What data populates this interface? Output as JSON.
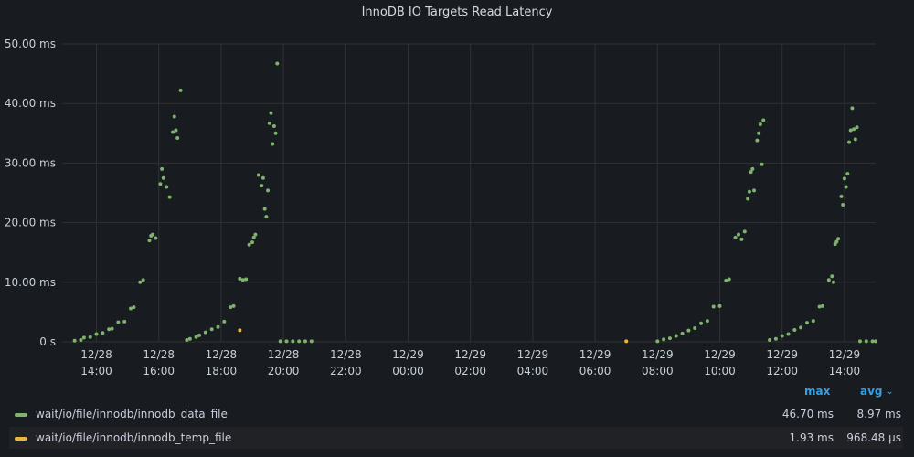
{
  "panel": {
    "title": "InnoDB IO Targets Read Latency"
  },
  "legend": {
    "col_max": "max",
    "col_avg": "avg",
    "sort_icon": "chevron-down-icon",
    "rows": [
      {
        "name": "wait/io/file/innodb/innodb_data_file",
        "color": "#7eb26d",
        "max": "46.70 ms",
        "avg": "8.97 ms"
      },
      {
        "name": "wait/io/file/innodb/innodb_temp_file",
        "color": "#eab839",
        "max": "1.93 ms",
        "avg": "968.48 µs"
      }
    ]
  },
  "chart_data": {
    "type": "scatter",
    "title": "InnoDB IO Targets Read Latency",
    "xlabel": "",
    "ylabel": "",
    "y_unit": "ms",
    "ylim": [
      0,
      50
    ],
    "y_ticks": [
      "0 s",
      "10.00 ms",
      "20.00 ms",
      "30.00 ms",
      "40.00 ms",
      "50.00 ms"
    ],
    "x_range_hours": [
      12.9,
      39.0
    ],
    "x_ticks": [
      {
        "date": "12/28",
        "time": "14:00"
      },
      {
        "date": "12/28",
        "time": "16:00"
      },
      {
        "date": "12/28",
        "time": "18:00"
      },
      {
        "date": "12/28",
        "time": "20:00"
      },
      {
        "date": "12/28",
        "time": "22:00"
      },
      {
        "date": "12/29",
        "time": "00:00"
      },
      {
        "date": "12/29",
        "time": "02:00"
      },
      {
        "date": "12/29",
        "time": "04:00"
      },
      {
        "date": "12/29",
        "time": "06:00"
      },
      {
        "date": "12/29",
        "time": "08:00"
      },
      {
        "date": "12/29",
        "time": "10:00"
      },
      {
        "date": "12/29",
        "time": "12:00"
      },
      {
        "date": "12/29",
        "time": "14:00"
      }
    ],
    "grid": true,
    "legend_position": "bottom",
    "series": [
      {
        "name": "wait/io/file/innodb/innodb_data_file",
        "color": "#7eb26d",
        "points": [
          [
            13.3,
            0.2
          ],
          [
            13.5,
            0.3
          ],
          [
            13.6,
            0.7
          ],
          [
            13.8,
            0.8
          ],
          [
            14.0,
            1.3
          ],
          [
            14.2,
            1.5
          ],
          [
            14.4,
            2.1
          ],
          [
            14.5,
            2.2
          ],
          [
            14.7,
            3.3
          ],
          [
            14.9,
            3.4
          ],
          [
            15.1,
            5.6
          ],
          [
            15.2,
            5.8
          ],
          [
            15.4,
            10.0
          ],
          [
            15.5,
            10.4
          ],
          [
            15.7,
            17.0
          ],
          [
            15.75,
            17.8
          ],
          [
            15.8,
            18.0
          ],
          [
            15.9,
            17.4
          ],
          [
            16.05,
            26.5
          ],
          [
            16.1,
            29.0
          ],
          [
            16.15,
            27.5
          ],
          [
            16.25,
            26.0
          ],
          [
            16.35,
            24.3
          ],
          [
            16.45,
            35.2
          ],
          [
            16.5,
            37.8
          ],
          [
            16.55,
            35.5
          ],
          [
            16.6,
            34.2
          ],
          [
            16.7,
            42.2
          ],
          [
            16.9,
            0.3
          ],
          [
            17.0,
            0.5
          ],
          [
            17.2,
            0.8
          ],
          [
            17.3,
            1.1
          ],
          [
            17.5,
            1.6
          ],
          [
            17.7,
            2.1
          ],
          [
            17.9,
            2.5
          ],
          [
            18.1,
            3.4
          ],
          [
            18.3,
            5.8
          ],
          [
            18.4,
            6.0
          ],
          [
            18.6,
            10.6
          ],
          [
            18.7,
            10.4
          ],
          [
            18.8,
            10.5
          ],
          [
            18.9,
            16.3
          ],
          [
            19.0,
            16.7
          ],
          [
            19.05,
            17.5
          ],
          [
            19.1,
            18.0
          ],
          [
            19.2,
            28.0
          ],
          [
            19.3,
            26.2
          ],
          [
            19.35,
            27.5
          ],
          [
            19.4,
            22.3
          ],
          [
            19.45,
            21.0
          ],
          [
            19.5,
            25.4
          ],
          [
            19.55,
            36.7
          ],
          [
            19.6,
            38.4
          ],
          [
            19.65,
            33.2
          ],
          [
            19.7,
            36.2
          ],
          [
            19.75,
            35.0
          ],
          [
            19.8,
            46.7
          ],
          [
            19.9,
            0.1
          ],
          [
            20.1,
            0.1
          ],
          [
            20.3,
            0.1
          ],
          [
            20.5,
            0.1
          ],
          [
            20.7,
            0.1
          ],
          [
            20.9,
            0.1
          ],
          [
            32.0,
            0.1
          ],
          [
            32.2,
            0.4
          ],
          [
            32.4,
            0.6
          ],
          [
            32.6,
            1.0
          ],
          [
            32.8,
            1.4
          ],
          [
            33.0,
            1.9
          ],
          [
            33.2,
            2.3
          ],
          [
            33.4,
            3.1
          ],
          [
            33.6,
            3.5
          ],
          [
            33.8,
            5.9
          ],
          [
            34.0,
            6.0
          ],
          [
            34.2,
            10.3
          ],
          [
            34.3,
            10.5
          ],
          [
            34.5,
            17.5
          ],
          [
            34.6,
            18.0
          ],
          [
            34.7,
            17.2
          ],
          [
            34.8,
            18.5
          ],
          [
            34.9,
            24.0
          ],
          [
            34.95,
            25.2
          ],
          [
            35.0,
            28.5
          ],
          [
            35.05,
            29.0
          ],
          [
            35.1,
            25.4
          ],
          [
            35.2,
            33.8
          ],
          [
            35.25,
            35.0
          ],
          [
            35.3,
            36.5
          ],
          [
            35.35,
            29.8
          ],
          [
            35.4,
            37.2
          ],
          [
            35.6,
            0.3
          ],
          [
            35.8,
            0.5
          ],
          [
            36.0,
            1.0
          ],
          [
            36.2,
            1.3
          ],
          [
            36.4,
            2.0
          ],
          [
            36.6,
            2.4
          ],
          [
            36.8,
            3.2
          ],
          [
            37.0,
            3.5
          ],
          [
            37.2,
            5.9
          ],
          [
            37.3,
            6.0
          ],
          [
            37.5,
            10.4
          ],
          [
            37.6,
            11.0
          ],
          [
            37.65,
            10.0
          ],
          [
            37.7,
            16.4
          ],
          [
            37.75,
            16.8
          ],
          [
            37.8,
            17.3
          ],
          [
            37.9,
            24.4
          ],
          [
            37.95,
            23.0
          ],
          [
            38.0,
            27.4
          ],
          [
            38.05,
            26.0
          ],
          [
            38.1,
            28.2
          ],
          [
            38.15,
            33.5
          ],
          [
            38.2,
            35.5
          ],
          [
            38.25,
            39.2
          ],
          [
            38.3,
            35.7
          ],
          [
            38.35,
            34.0
          ],
          [
            38.4,
            36.0
          ],
          [
            38.5,
            0.1
          ],
          [
            38.7,
            0.1
          ],
          [
            38.9,
            0.1
          ],
          [
            39.0,
            0.1
          ],
          [
            39.2,
            0.1
          ],
          [
            39.4,
            0.1
          ],
          [
            39.6,
            0.3
          ]
        ]
      },
      {
        "name": "wait/io/file/innodb/innodb_temp_file",
        "color": "#eab839",
        "points": [
          [
            18.6,
            1.93
          ],
          [
            31.0,
            0.1
          ]
        ]
      }
    ]
  }
}
